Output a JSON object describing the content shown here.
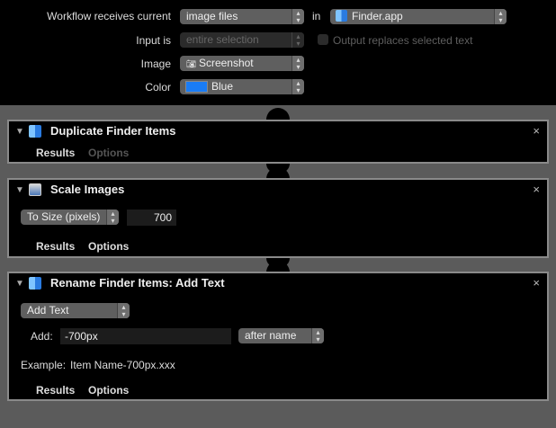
{
  "header": {
    "receives_label": "Workflow receives current",
    "receives_value": "image files",
    "in_label": "in",
    "app_value": "Finder.app",
    "input_label": "Input is",
    "input_value": "entire selection",
    "output_checkbox_label": "Output replaces selected text",
    "output_checked": false,
    "image_label": "Image",
    "image_value": "Screenshot",
    "color_label": "Color",
    "color_value": "Blue",
    "color_swatch": "#1a7cf5"
  },
  "actions": [
    {
      "title": "Duplicate Finder Items",
      "results": "Results",
      "options": "Options"
    },
    {
      "title": "Scale Images",
      "mode": "To Size (pixels)",
      "size": "700",
      "results": "Results",
      "options": "Options"
    },
    {
      "title": "Rename Finder Items: Add Text",
      "mode": "Add Text",
      "add_label": "Add:",
      "add_value": "-700px",
      "position": "after name",
      "example_label": "Example:",
      "example_value": "Item Name-700px.xxx",
      "results": "Results",
      "options": "Options"
    }
  ]
}
